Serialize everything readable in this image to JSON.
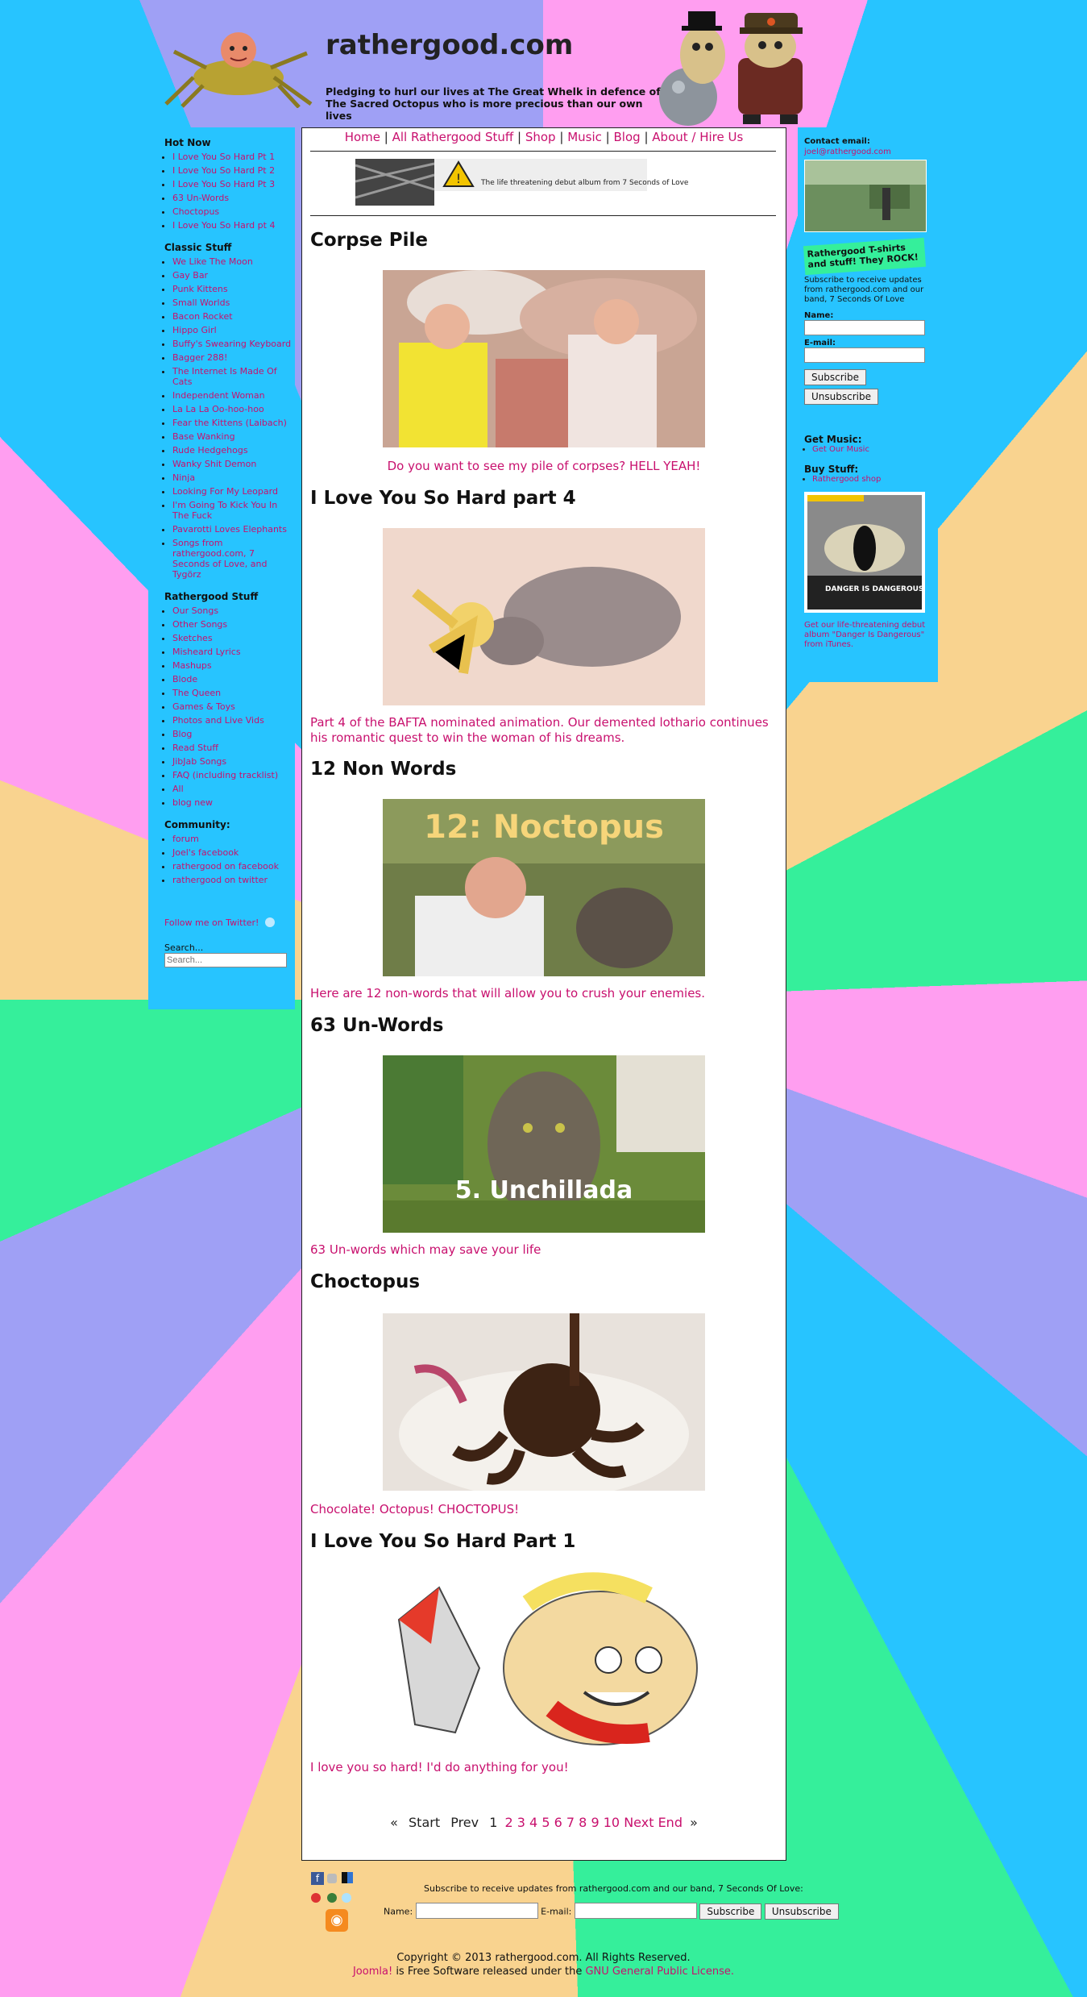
{
  "site": {
    "title": "rathergood.com",
    "tagline": "Pledging to hurl our lives at The Great Whelk in defence of The Sacred Octopus who is more precious than our own lives"
  },
  "nav": {
    "items": [
      "Home",
      "All Rathergood Stuff",
      "Shop",
      "Music",
      "Blog",
      "About / Hire Us"
    ],
    "separator": "|"
  },
  "banner": {
    "text": "The life threatening debut album from 7 Seconds of Love"
  },
  "left_sidebar": {
    "hot_now": {
      "title": "Hot Now",
      "items": [
        "I Love You So Hard Pt 1",
        "I Love You So Hard Pt 2",
        "I Love You So Hard Pt 3",
        "63 Un-Words",
        "Choctopus",
        "I Love You So Hard pt 4"
      ]
    },
    "classic": {
      "title": "Classic Stuff",
      "items": [
        "We Like The Moon",
        "Gay Bar",
        "Punk Kittens",
        "Small Worlds",
        "Bacon Rocket",
        "Hippo Girl",
        "Buffy's Swearing Keyboard",
        "Bagger 288!",
        "The Internet Is Made Of Cats",
        "Independent Woman",
        "La La La Oo-hoo-hoo",
        "Fear the Kittens (Laibach)",
        "Base Wanking",
        "Rude Hedgehogs",
        "Wanky Shit Demon",
        "Ninja",
        "Looking For My Leopard",
        "I'm Going To Kick You In The Fuck",
        "Pavarotti Loves Elephants",
        "Songs from rathergood.com, 7 Seconds of Love, and Tygörz"
      ]
    },
    "rathergood": {
      "title": "Rathergood Stuff",
      "items": [
        "Our Songs",
        "Other Songs",
        "Sketches",
        "Misheard Lyrics",
        "Mashups",
        "Blode",
        "The Queen",
        "Games & Toys",
        "Photos and Live Vids",
        "Blog",
        "Read Stuff",
        "JibJab Songs",
        "FAQ (including tracklist)",
        "All",
        "blog new"
      ]
    },
    "community": {
      "title": "Community:",
      "items": [
        "forum",
        "Joel's facebook",
        "rathergood on facebook",
        "rathergood on twitter"
      ]
    },
    "twitter_text": "Follow me on Twitter!",
    "search_label": "Search...",
    "search_placeholder": "Search..."
  },
  "articles": [
    {
      "title": "Corpse Pile",
      "text": "Do you want to see my pile of corpses? HELL YEAH!",
      "center": true
    },
    {
      "title": "I Love You So Hard part 4",
      "text": "Part 4 of the BAFTA nominated animation. Our demented lothario continues his romantic quest to win the woman of his dreams.",
      "center": false
    },
    {
      "title": "12 Non Words",
      "text": "Here are 12 non-words that will allow you to crush your enemies.",
      "center": false,
      "overlay": "12: Noctopus"
    },
    {
      "title": "63 Un-Words",
      "text": "63 Un-words which may save your life",
      "center": false,
      "overlay": "5. Unchillada"
    },
    {
      "title": "Choctopus",
      "text": "Chocolate! Octopus! CHOCTOPUS!",
      "center": false
    },
    {
      "title": "I Love You So Hard Part 1",
      "text": "I love you so hard! I'd do anything for you!",
      "center": false
    }
  ],
  "pager": {
    "first_arrow": "«",
    "start": "Start",
    "prev": "Prev",
    "pages": [
      "1",
      "2",
      "3",
      "4",
      "5",
      "6",
      "7",
      "8",
      "9",
      "10"
    ],
    "next": "Next",
    "end": "End",
    "last_arrow": "»"
  },
  "right_sidebar": {
    "contact_label": "Contact email:",
    "contact_email": "joel@rathergood.com",
    "tshirt_banner": "Rathergood T-shirts and stuff! They ROCK!",
    "subscribe_text": "Subscribe to receive updates from rathergood.com and our band, 7 Seconds Of Love",
    "name_label": "Name:",
    "email_label": "E-mail:",
    "subscribe_button": "Subscribe",
    "unsubscribe_button": "Unsubscribe",
    "get_music_title": "Get Music:",
    "get_music_link": "Get Our Music",
    "buy_title": "Buy Stuff:",
    "buy_link": "Rathergood shop",
    "album_overlay": "DANGER IS DANGEROUS",
    "album_text": "Get our life-threatening debut album \"Danger Is Dangerous\" from iTunes."
  },
  "footer": {
    "subscribe_text": "Subscribe to receive updates from rathergood.com and our band, 7 Seconds Of Love:",
    "name_label": "Name:",
    "email_label": "E-mail:",
    "subscribe_button": "Subscribe",
    "unsubscribe_button": "Unsubscribe",
    "copyright": "Copyright © 2013 rathergood.com. All Rights Reserved.",
    "joomla_link": "Joomla!",
    "license_text": "is Free Software released under the",
    "license_link": "GNU General Public License."
  },
  "colors": {
    "link": "#c8106e",
    "sidebar_bg": "#27c4ff",
    "content_bg": "#ffffff"
  }
}
